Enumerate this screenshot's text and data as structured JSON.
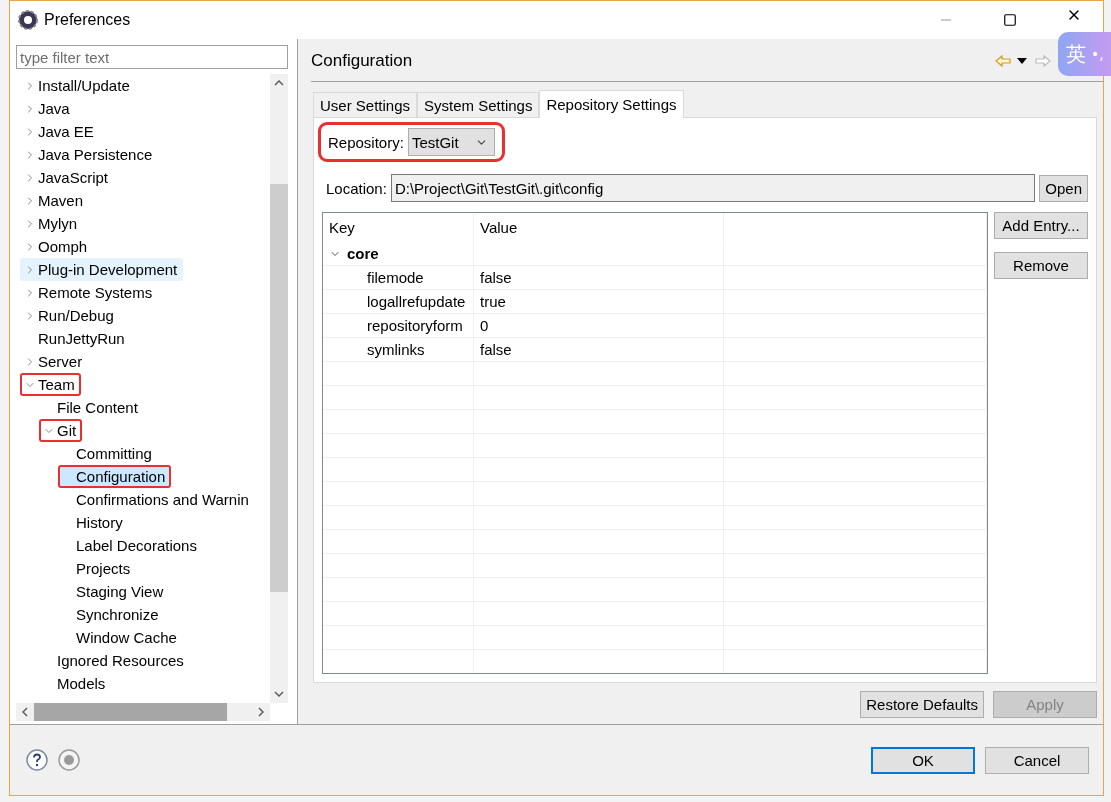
{
  "window": {
    "title": "Preferences"
  },
  "filter": {
    "placeholder": "type filter text"
  },
  "tree": [
    {
      "label": "Install/Update",
      "expandable": true,
      "expanded": false,
      "selected": false,
      "hovered": false,
      "marked": false
    },
    {
      "label": "Java",
      "expandable": true,
      "expanded": false,
      "selected": false,
      "hovered": false,
      "marked": false
    },
    {
      "label": "Java EE",
      "expandable": true,
      "expanded": false,
      "selected": false,
      "hovered": false,
      "marked": false
    },
    {
      "label": "Java Persistence",
      "expandable": true,
      "expanded": false,
      "selected": false,
      "hovered": false,
      "marked": false
    },
    {
      "label": "JavaScript",
      "expandable": true,
      "expanded": false,
      "selected": false,
      "hovered": false,
      "marked": false
    },
    {
      "label": "Maven",
      "expandable": true,
      "expanded": false,
      "selected": false,
      "hovered": false,
      "marked": false
    },
    {
      "label": "Mylyn",
      "expandable": true,
      "expanded": false,
      "selected": false,
      "hovered": false,
      "marked": false
    },
    {
      "label": "Oomph",
      "expandable": true,
      "expanded": false,
      "selected": false,
      "hovered": false,
      "marked": false
    },
    {
      "label": "Plug-in Development",
      "expandable": true,
      "expanded": false,
      "selected": false,
      "hovered": true,
      "marked": false
    },
    {
      "label": "Remote Systems",
      "expandable": true,
      "expanded": false,
      "selected": false,
      "hovered": false,
      "marked": false
    },
    {
      "label": "Run/Debug",
      "expandable": true,
      "expanded": false,
      "selected": false,
      "hovered": false,
      "marked": false
    },
    {
      "label": "RunJettyRun",
      "expandable": false,
      "selected": false,
      "hovered": false,
      "marked": false
    },
    {
      "label": "Server",
      "expandable": true,
      "expanded": false,
      "selected": false,
      "hovered": false,
      "marked": false
    },
    {
      "label": "Team",
      "expandable": true,
      "expanded": true,
      "selected": false,
      "hovered": false,
      "marked": true,
      "children": [
        {
          "label": "File Content",
          "expandable": false,
          "selected": false,
          "hovered": false,
          "marked": false
        },
        {
          "label": "Git",
          "expandable": true,
          "expanded": true,
          "selected": false,
          "hovered": false,
          "marked": true,
          "children": [
            {
              "label": "Committing",
              "expandable": false,
              "selected": false,
              "hovered": false,
              "marked": false
            },
            {
              "label": "Configuration",
              "expandable": false,
              "selected": true,
              "hovered": false,
              "marked": true
            },
            {
              "label": "Confirmations and Warnin",
              "expandable": false,
              "selected": false,
              "hovered": false,
              "marked": false
            },
            {
              "label": "History",
              "expandable": false,
              "selected": false,
              "hovered": false,
              "marked": false
            },
            {
              "label": "Label Decorations",
              "expandable": false,
              "selected": false,
              "hovered": false,
              "marked": false
            },
            {
              "label": "Projects",
              "expandable": false,
              "selected": false,
              "hovered": false,
              "marked": false
            },
            {
              "label": "Staging View",
              "expandable": false,
              "selected": false,
              "hovered": false,
              "marked": false
            },
            {
              "label": "Synchronize",
              "expandable": false,
              "selected": false,
              "hovered": false,
              "marked": false
            },
            {
              "label": "Window Cache",
              "expandable": false,
              "selected": false,
              "hovered": false,
              "marked": false
            }
          ]
        },
        {
          "label": "Ignored Resources",
          "expandable": false,
          "selected": false,
          "hovered": false,
          "marked": false
        },
        {
          "label": "Models",
          "expandable": false,
          "selected": false,
          "hovered": false,
          "marked": false
        }
      ]
    }
  ],
  "page": {
    "title": "Configuration"
  },
  "tabs": [
    {
      "label": "User Settings",
      "selected": false
    },
    {
      "label": "System Settings",
      "selected": false
    },
    {
      "label": "Repository Settings",
      "selected": true
    }
  ],
  "repository": {
    "label": "Repository:",
    "value": "TestGit",
    "marked": true
  },
  "location": {
    "label": "Location:",
    "value": "D:\\Project\\Git\\TestGit\\.git\\config",
    "button": "Open"
  },
  "config_table": {
    "columns": [
      "Key",
      "Value"
    ],
    "sections": [
      {
        "name": "core",
        "expanded": true,
        "entries": [
          {
            "key": "filemode",
            "value": "false"
          },
          {
            "key": "logallrefupdate",
            "value": "true"
          },
          {
            "key": "repositoryform",
            "value": "0"
          },
          {
            "key": "symlinks",
            "value": "false"
          }
        ]
      }
    ]
  },
  "table_buttons": [
    "Add Entry...",
    "Remove"
  ],
  "page_buttons": [
    {
      "label": "Restore Defaults",
      "disabled": false
    },
    {
      "label": "Apply",
      "disabled": true
    }
  ],
  "dialog_buttons": [
    {
      "label": "OK",
      "default": true
    },
    {
      "label": "Cancel",
      "default": false
    }
  ],
  "ime": {
    "mode": "英",
    "punct": "•,"
  }
}
